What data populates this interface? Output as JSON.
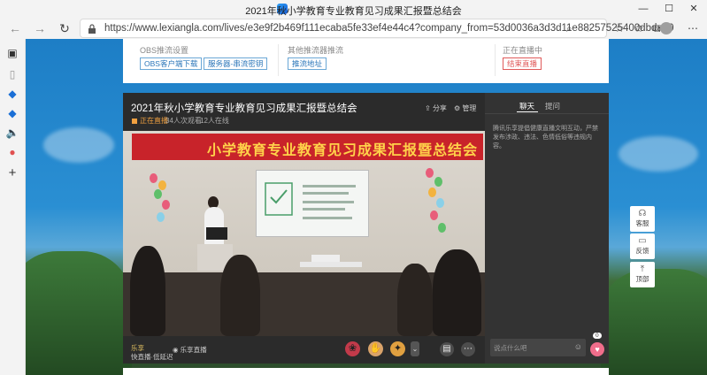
{
  "browser": {
    "window_title": "2021年秋小学教育专业教育见习成果汇报暨总结会",
    "url": "https://www.lexiangla.com/lives/e3e9f2b469f111ecaba5fe33ef4e44c4?company_from=53d0036a3d3d11e88257525400dbda40"
  },
  "stream_setup": {
    "obs_label": "OBS推流设置",
    "obs_download_btn": "OBS客户端下载",
    "server_key_btn": "服务器-串流密钥",
    "encoder_label": "其他推流器推流",
    "push_url_btn": "推流地址",
    "status_label": "正在直播中",
    "end_live_btn": "结束直播"
  },
  "player": {
    "title": "2021年秋小学教育专业教育见习成果汇报暨总结会",
    "live_status": "正在直播",
    "views": "34人次观看",
    "online": "12人在线",
    "share": "分享",
    "manage": "管理",
    "banner_text": "小学教育专业教育见习成果汇报暨总结会",
    "brand_badge": "乐享",
    "brand_text": "快直播·低延迟",
    "share_live": "乐享直播"
  },
  "chat": {
    "tab_chat": "聊天",
    "tab_qa": "提问",
    "notice": "腾讯乐享提倡健康直播文明互动，严禁发布涉政、违法、色情低俗等违规内容。",
    "input_placeholder": "说点什么吧",
    "like_count": "0"
  },
  "tools": {
    "service": "客服",
    "feedback": "反馈",
    "top": "顶部"
  }
}
